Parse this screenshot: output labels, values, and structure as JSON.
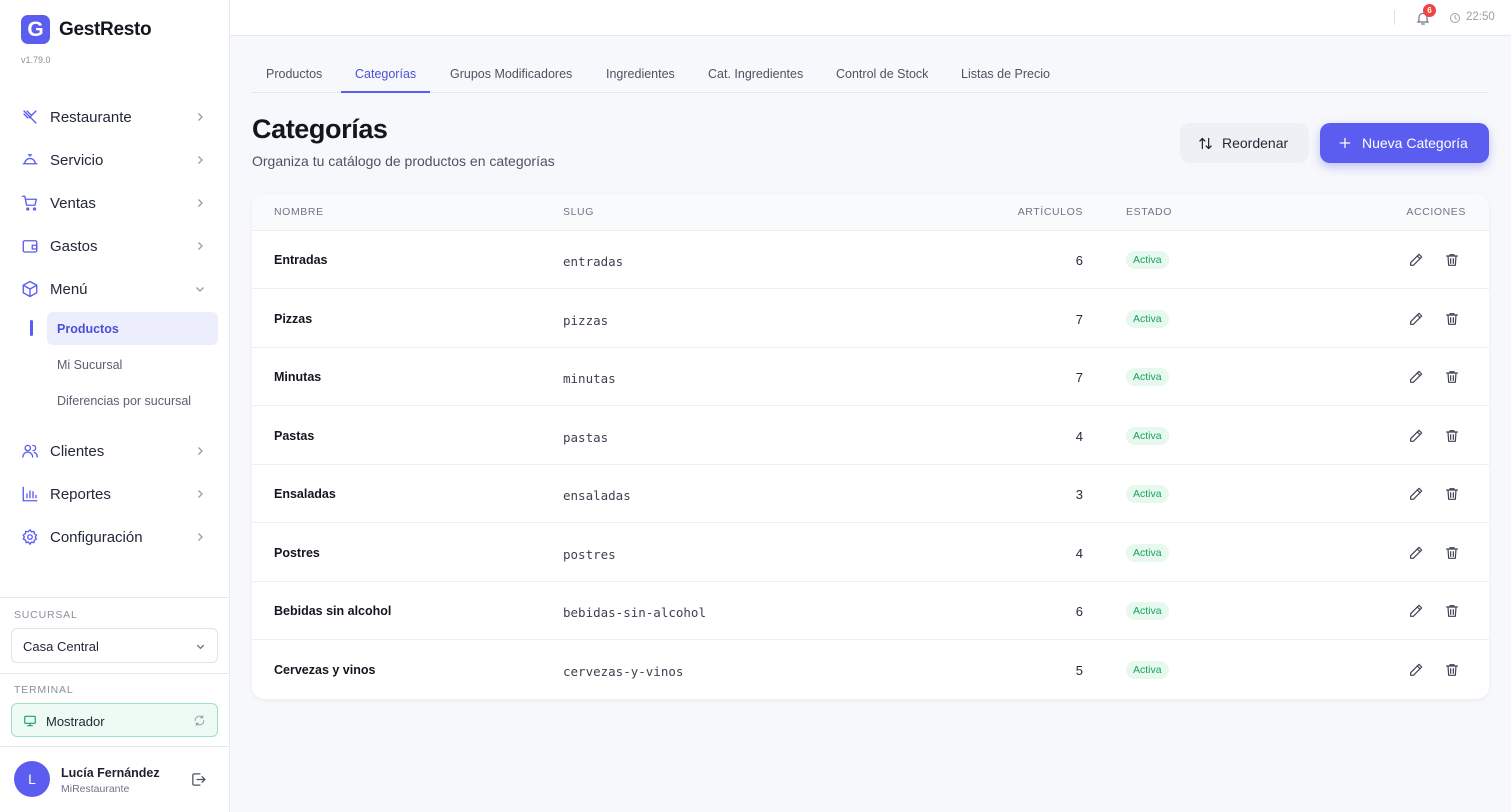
{
  "app": {
    "logo_letter": "G",
    "name": "GestResto",
    "version": "v1.79.0"
  },
  "sidebar": {
    "nav": [
      {
        "label": "Restaurante",
        "icon": "utensils-icon"
      },
      {
        "label": "Servicio",
        "icon": "service-bell-icon"
      },
      {
        "label": "Ventas",
        "icon": "shopping-cart-icon"
      },
      {
        "label": "Gastos",
        "icon": "wallet-icon"
      },
      {
        "label": "Menú",
        "icon": "package-icon",
        "expanded": true
      },
      {
        "label": "Clientes",
        "icon": "users-icon"
      },
      {
        "label": "Reportes",
        "icon": "bar-chart-icon"
      },
      {
        "label": "Configuración",
        "icon": "gear-icon"
      }
    ],
    "menu_sub": [
      {
        "label": "Productos",
        "active": true
      },
      {
        "label": "Mi Sucursal"
      },
      {
        "label": "Diferencias por sucursal"
      }
    ],
    "branch_label": "SUCURSAL",
    "branch_value": "Casa Central",
    "terminal_label": "TERMINAL",
    "terminal_value": "Mostrador",
    "user": {
      "initial": "L",
      "name": "Lucía Fernández",
      "org": "MiRestaurante"
    }
  },
  "topbar": {
    "notifications": "6",
    "time": "22:50"
  },
  "tabs": [
    {
      "label": "Productos"
    },
    {
      "label": "Categorías",
      "active": true
    },
    {
      "label": "Grupos Modificadores"
    },
    {
      "label": "Ingredientes"
    },
    {
      "label": "Cat. Ingredientes"
    },
    {
      "label": "Control de Stock"
    },
    {
      "label": "Listas de Precio"
    }
  ],
  "page": {
    "title": "Categorías",
    "subtitle": "Organiza tu catálogo de productos en categorías",
    "reorder_label": "Reordenar",
    "new_label": "Nueva Categoría"
  },
  "table": {
    "headers": {
      "name": "NOMBRE",
      "slug": "SLUG",
      "count": "ARTÍCULOS",
      "status": "ESTADO",
      "actions": "ACCIONES"
    },
    "rows": [
      {
        "name": "Entradas",
        "slug": "entradas",
        "count": "6",
        "status": "Activa"
      },
      {
        "name": "Pizzas",
        "slug": "pizzas",
        "count": "7",
        "status": "Activa"
      },
      {
        "name": "Minutas",
        "slug": "minutas",
        "count": "7",
        "status": "Activa"
      },
      {
        "name": "Pastas",
        "slug": "pastas",
        "count": "4",
        "status": "Activa"
      },
      {
        "name": "Ensaladas",
        "slug": "ensaladas",
        "count": "3",
        "status": "Activa"
      },
      {
        "name": "Postres",
        "slug": "postres",
        "count": "4",
        "status": "Activa"
      },
      {
        "name": "Bebidas sin alcohol",
        "slug": "bebidas-sin-alcohol",
        "count": "6",
        "status": "Activa"
      },
      {
        "name": "Cervezas y vinos",
        "slug": "cervezas-y-vinos",
        "count": "5",
        "status": "Activa"
      }
    ]
  },
  "colors": {
    "accent": "#5b5cf0",
    "active_text": "#4b4fd8",
    "success": "#18a35f",
    "danger": "#ef4444"
  }
}
